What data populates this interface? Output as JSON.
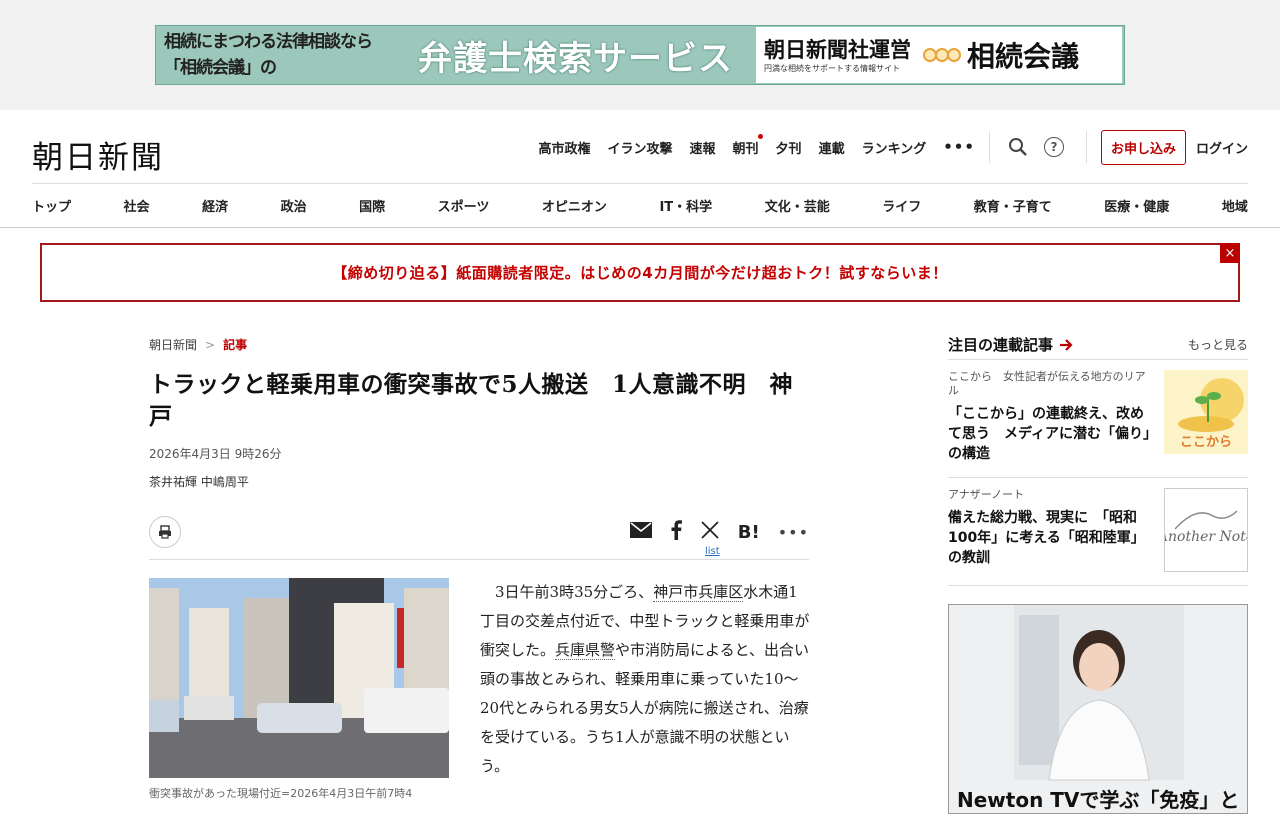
{
  "ad": {
    "line1": "相続にまつわる法律相談なら",
    "line2": "「相続会議」の",
    "headline": "弁護士検索サービス",
    "org": "朝日新聞社運営",
    "tagline": "円満な相続をサポートする情報サイト",
    "brand": "相続会議"
  },
  "header": {
    "logo": "朝日新聞",
    "topnav": [
      "高市政権",
      "イラン攻撃",
      "速報",
      "朝刊",
      "夕刊",
      "連載",
      "ランキング"
    ],
    "more": "•••",
    "help": "?",
    "apply": "お申し込み",
    "login": "ログイン"
  },
  "sections": [
    "トップ",
    "社会",
    "経済",
    "政治",
    "国際",
    "スポーツ",
    "オピニオン",
    "IT・科学",
    "文化・芸能",
    "ライフ",
    "教育・子育て",
    "医療・健康",
    "地域"
  ],
  "promo": {
    "text": "【締め切り迫る】紙面購読者限定。はじめの4カ月間が今だけ超おトク！試すならいま！",
    "close": "×"
  },
  "article": {
    "breadcrumb": [
      "朝日新聞",
      "記事"
    ],
    "breadcrumb_sep": ">",
    "title": "トラックと軽乗用車の衝突事故で5人搬送　1人意識不明　神戸",
    "date": "2026年4月3日 9時26分",
    "authors": "茶井祐輝 中嶋周平",
    "list_link": "list",
    "hatena": "B!",
    "share_more": "•••",
    "caption": "衝突事故があった現場付近=2026年4月3日午前7時4",
    "body": {
      "p1": "3日午前3時35分ごろ、",
      "kw1": "神戸市兵庫区",
      "p2": "水木通1丁目の交差点付近で、中型トラックと軽乗用車が衝突した。",
      "kw2": "兵庫県警",
      "p3": "や市消防局によると、出合い頭の事故とみられ、軽乗用車に乗っていた10～20代とみられる男女5人が病院に搬送され、治療を受けている。うち1人が意識不明の状態という。"
    }
  },
  "sidebar": {
    "title": "注目の連載記事",
    "more": "もっと見る",
    "items": [
      {
        "category": "ここから　女性記者が伝える地方のリアル",
        "title": "「ここから」の連載終え、改めて思う　メディアに潜む「偏り」の構造",
        "thumb_label": "ここから"
      },
      {
        "category": "アナザーノート",
        "title": "備えた総力戦、現実に　「昭和100年」に考える「昭和陸軍」の教訓",
        "thumb_label": "Another Note"
      }
    ],
    "ad_text": "Newton TVで学ぶ「免疫」と"
  },
  "colors": {
    "accent": "#b00000",
    "ad_green": "#9cc7bb"
  }
}
